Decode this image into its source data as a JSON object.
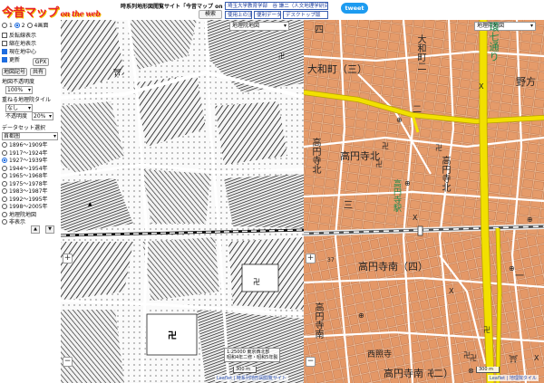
{
  "header": {
    "logo_main": "今昔マップ",
    "logo_sub": "on the web",
    "site_title": "時系列地形図閲覧サイト「今昔マップ on the web」",
    "search_label": "検索",
    "links": [
      "埼玉大学教育学部　谷 謙二（人文地理学研究室）",
      "使用上の注意",
      "便利データ",
      "デスクトップ版"
    ],
    "tweet_label": "tweet"
  },
  "sidebar": {
    "panes": [
      "1",
      "2",
      "4画面"
    ],
    "pane_selected": "2",
    "checkboxes": [
      {
        "label": "反転線表示",
        "checked": false
      },
      {
        "label": "縮在地表示",
        "checked": false
      },
      {
        "label": "現在地中心",
        "checked": true
      },
      {
        "label": "更新",
        "checked": true
      }
    ],
    "gpx_label": "GPX",
    "map_register_label": "地図記号",
    "share_label": "共有",
    "opacity_heading": "地図不透明度",
    "opacity_value": "100%",
    "overlay_heading": "重ねる地理院タイル",
    "overlay_value": "なし",
    "transparency_label": "不透明度",
    "transparency_value": "20%",
    "dataset_heading": "データセット選択",
    "dataset_value": "首都圏",
    "eras": [
      {
        "label": "1896〜1909年",
        "selected": false
      },
      {
        "label": "1917〜1924年",
        "selected": false
      },
      {
        "label": "1927〜1939年",
        "selected": true
      },
      {
        "label": "1944〜1954年",
        "selected": false
      },
      {
        "label": "1965〜1968年",
        "selected": false
      },
      {
        "label": "1975〜1978年",
        "selected": false
      },
      {
        "label": "1983〜1987年",
        "selected": false
      },
      {
        "label": "1992〜1995年",
        "selected": false
      },
      {
        "label": "1998〜2005年",
        "selected": false
      },
      {
        "label": "地理院地図",
        "selected": false
      },
      {
        "label": "非表示",
        "selected": false
      }
    ],
    "up_label": "▲",
    "down_label": "▼"
  },
  "left_map": {
    "layer_value": "地理院地図",
    "zoom_in": "+",
    "zoom_out": "−",
    "position_lines": [
      "1:25000 東京西北部",
      "昭和4年二修・昭和5年製"
    ],
    "scale_label": "300 m",
    "attribution": "Leaflet | 時系列地形図閲覧サイト"
  },
  "right_map": {
    "layer_value": "地理院地図",
    "zoom_in": "+",
    "zoom_out": "−",
    "scale_label": "300 m",
    "attribution": "Leaflet | 地理院タイル",
    "road_name": "環七通り",
    "labels": {
      "daiwa_town": "大和町（三）",
      "daiwa_vert": "大和町二",
      "nobu": "野方",
      "koenji_kita_1": "高円寺北",
      "koenji_kita_2": "高円寺北",
      "koenji_kita_3": "高円寺北",
      "koenji_station": "高円寺駅",
      "koenji_minami_4": "高円寺南（四）",
      "koenji_minami_3": "高円寺南",
      "koenji_minami_2": "高円寺南（二）",
      "nishi_shoji": "西照寺",
      "number_37": "37",
      "k_shi": "四",
      "k_san": "三",
      "k_ni": "二",
      "k_ichi": "一"
    }
  },
  "colors": {
    "road_major": "#f2e000",
    "map_land": "#eab58f",
    "rail": "#555555",
    "link_border": "#3a5fb0",
    "tweet": "#1d9bf0"
  }
}
